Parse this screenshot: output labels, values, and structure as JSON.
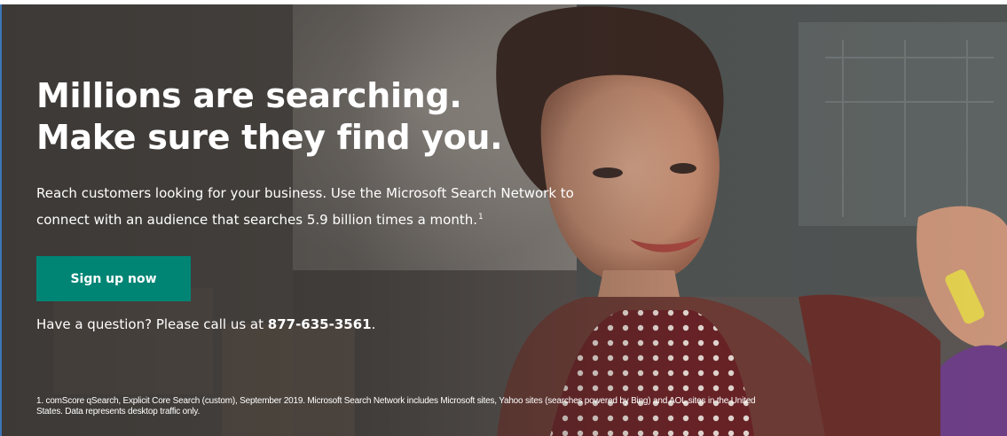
{
  "hero": {
    "headline_line1": "Millions are searching.",
    "headline_line2": "Make sure they find you.",
    "subtext_line1": "Reach customers looking for your business. Use the Microsoft Search Network to",
    "subtext_line2": "connect with an audience that searches 5.9 billion times a month.",
    "subtext_superscript": "1",
    "cta_label": "Sign up now",
    "question_prefix": "Have a question? Please call us at ",
    "phone_number": "877-635-3561",
    "question_suffix": ".",
    "footnote": "1. comScore qSearch, Explicit Core Search (custom), September 2019. Microsoft Search Network includes Microsoft sites, Yahoo sites (searches powered by Bing) and AOL sites in the United States. Data represents desktop traffic only."
  },
  "colors": {
    "cta_background": "#008575",
    "text": "#ffffff",
    "left_edge_accent": "#3c76b6"
  }
}
